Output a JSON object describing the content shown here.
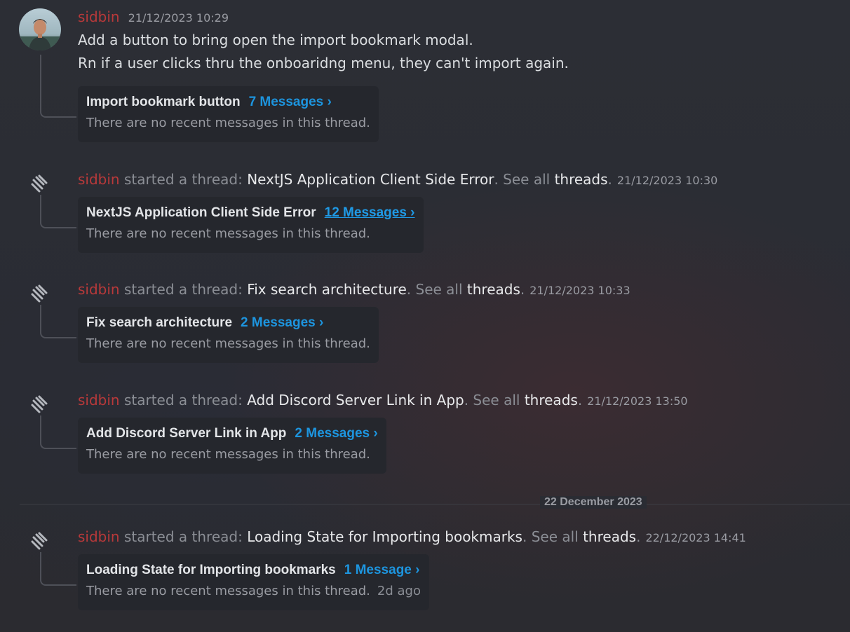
{
  "first_message": {
    "author": "sidbin",
    "timestamp": "21/12/2023 10:29",
    "lines": [
      "Add a button to bring open the import bookmark modal.",
      "Rn if a user clicks thru the onboaridng menu, they can't import again."
    ],
    "thread": {
      "title": "Import bookmark button",
      "messages_link": "7 Messages ›",
      "subtext": "There are no recent messages in this thread."
    }
  },
  "thread_starts": [
    {
      "author": "sidbin",
      "action": "started a thread:",
      "title": "NextJS Application Client Side Error",
      "see_all": ". See all",
      "threads_word": "threads",
      "period": ".",
      "timestamp": "21/12/2023 10:30",
      "card_title": "NextJS Application Client Side Error",
      "messages_link": "12 Messages ›",
      "subtext": "There are no recent messages in this thread."
    },
    {
      "author": "sidbin",
      "action": "started a thread:",
      "title": "Fix search architecture",
      "see_all": ". See all",
      "threads_word": "threads",
      "period": ".",
      "timestamp": "21/12/2023 10:33",
      "card_title": "Fix search architecture",
      "messages_link": "2 Messages ›",
      "subtext": "There are no recent messages in this thread."
    },
    {
      "author": "sidbin",
      "action": "started a thread:",
      "title": "Add Discord Server Link in App",
      "see_all": ". See all",
      "threads_word": "threads",
      "period": ".",
      "timestamp": "21/12/2023 13:50",
      "card_title": "Add Discord Server Link in App",
      "messages_link": "2 Messages ›",
      "subtext": "There are no recent messages in this thread."
    },
    {
      "author": "sidbin",
      "action": "started a thread:",
      "title": "Loading State for Importing bookmarks",
      "see_all": ". See all",
      "threads_word": "threads",
      "period": ".",
      "timestamp": "22/12/2023 14:41",
      "card_title": "Loading State for Importing bookmarks",
      "messages_link": "1 Message ›",
      "subtext": "There are no recent messages in this thread.",
      "ago": "2d ago"
    }
  ],
  "date_divider": "22 December 2023",
  "colors": {
    "author": "#b8393a",
    "link": "#1d95df",
    "background": "#2b2d33",
    "card": "#25272d"
  },
  "icons": [
    "avatar",
    "thread-icon"
  ]
}
